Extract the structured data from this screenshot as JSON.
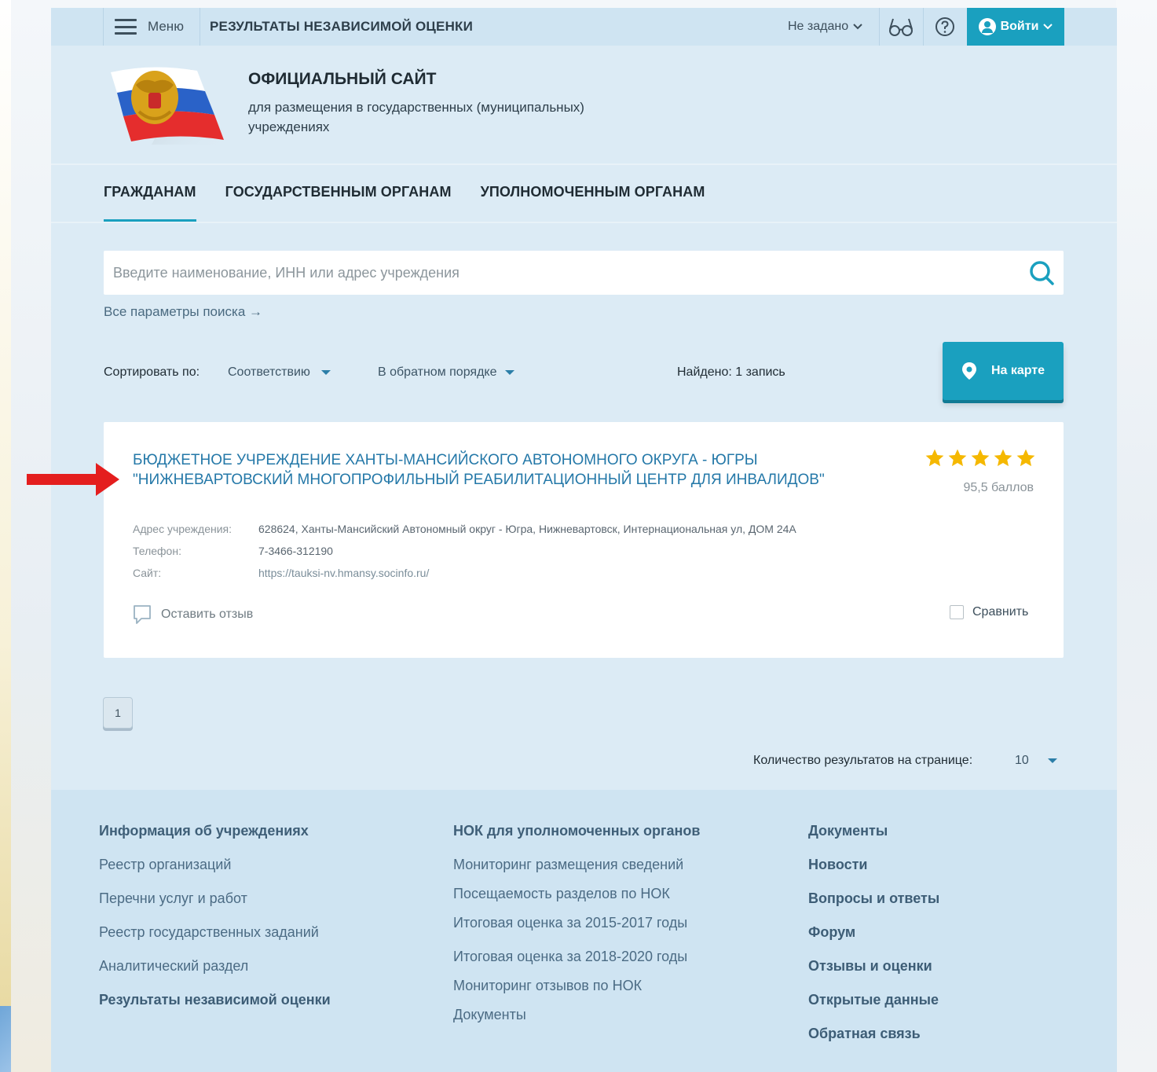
{
  "topbar": {
    "menu_label": "Меню",
    "title": "РЕЗУЛЬТАТЫ НЕЗАВИСИМОЙ ОЦЕНКИ",
    "region": "Не задано",
    "login_label": "Войти"
  },
  "header": {
    "site_title": "ОФИЦИАЛЬНЫЙ САЙТ",
    "site_subtitle": "для размещения в государственных (муниципальных) учреждениях"
  },
  "tabs": [
    {
      "label": "ГРАЖДАНАМ",
      "active": true
    },
    {
      "label": "ГОСУДАРСТВЕННЫМ ОРГАНАМ",
      "active": false
    },
    {
      "label": "УПОЛНОМОЧЕННЫМ ОРГАНАМ",
      "active": false
    }
  ],
  "search": {
    "placeholder": "Введите наименование, ИНН или адрес учреждения",
    "value": "",
    "all_params": "Все параметры поиска →"
  },
  "sort": {
    "label": "Сортировать по:",
    "by": "Соответствию",
    "order": "В обратном порядке",
    "found": "Найдено: 1 запись",
    "map_button": "На карте"
  },
  "result": {
    "title_line1": "БЮДЖЕТНОЕ УЧРЕЖДЕНИЕ ХАНТЫ-МАНСИЙСКОГО АВТОНОМНОГО ОКРУГА - ЮГРЫ",
    "title_line2": "\"НИЖНЕВАРТОВСКИЙ МНОГОПРОФИЛЬНЫЙ РЕАБИЛИТАЦИОННЫЙ ЦЕНТР ДЛЯ ИНВАЛИДОВ\"",
    "rating_stars": 5,
    "score": "95,5 баллов",
    "address_label": "Адрес учреждения:",
    "address": "628624, Ханты-Мансийский Автономный округ - Югра, Нижневартовск, Интернациональная ул, ДОМ 24А",
    "phone_label": "Телефон:",
    "phone": "7-3466-312190",
    "site_label": "Сайт:",
    "site": "https://tauksi-nv.hmansy.socinfo.ru/",
    "review_label": "Оставить отзыв",
    "compare_label": "Сравнить"
  },
  "pagination": {
    "current_page": "1",
    "per_page_label": "Количество результатов на странице:",
    "per_page_value": "10"
  },
  "footer": {
    "col1": [
      "Информация об учреждениях",
      "Реестр организаций",
      "Перечни услуг и работ",
      "Реестр государственных заданий",
      "Аналитический раздел",
      "Результаты независимой оценки"
    ],
    "col2": [
      "НОК для уполномоченных органов",
      "Мониторинг размещения сведений",
      "Посещаемость разделов по НОК",
      "Итоговая оценка за 2015-2017 годы",
      "Итоговая оценка за 2018-2020 годы",
      "Мониторинг отзывов по НОК",
      "Документы"
    ],
    "col3": [
      "Документы",
      "Новости",
      "Вопросы и ответы",
      "Форум",
      "Отзывы и оценки",
      "Открытые данные",
      "Обратная связь"
    ]
  },
  "colors": {
    "accent": "#1aa0bf",
    "link": "#2478a8",
    "star": "#f5b800",
    "arrow": "#e41e1e"
  }
}
